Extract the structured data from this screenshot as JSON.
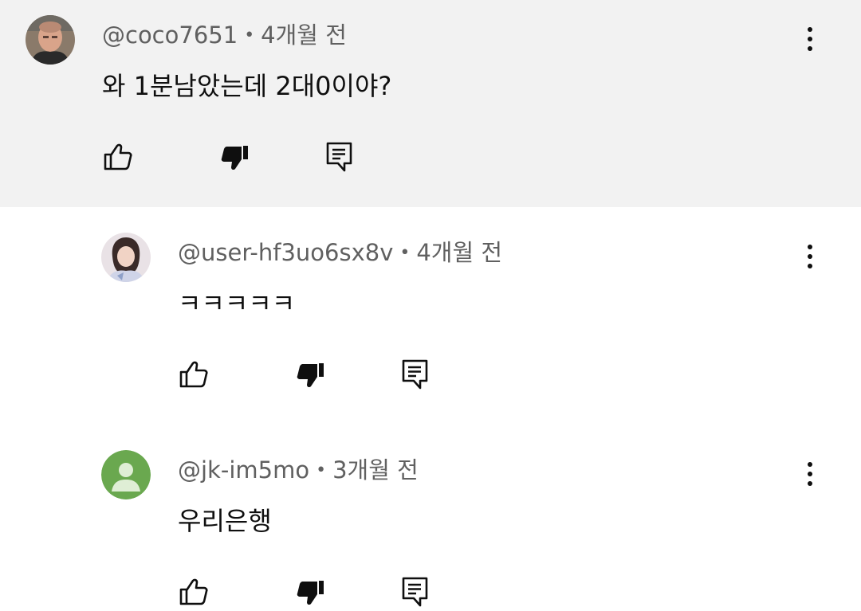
{
  "comments": [
    {
      "author": "@coco7651",
      "time": "4개월 전",
      "separator": "•",
      "text": "와 1분남았는데 2대0이야?",
      "avatar_icon": "photo-avatar-man",
      "highlighted": true,
      "disliked": true
    },
    {
      "author": "@user-hf3uo6sx8v",
      "time": "4개월 전",
      "separator": "•",
      "text": "ㅋㅋㅋㅋㅋ",
      "avatar_icon": "photo-avatar-woman",
      "highlighted": false,
      "disliked": true
    },
    {
      "author": "@jk-im5mo",
      "time": "3개월 전",
      "separator": "•",
      "text": "우리은행",
      "avatar_icon": "default-person-avatar",
      "avatar_color": "#6aa84f",
      "highlighted": false,
      "disliked": true
    }
  ],
  "colors": {
    "highlight_bg": "#f2f2f2",
    "meta_text": "#606060",
    "primary_text": "#0f0f0f"
  }
}
